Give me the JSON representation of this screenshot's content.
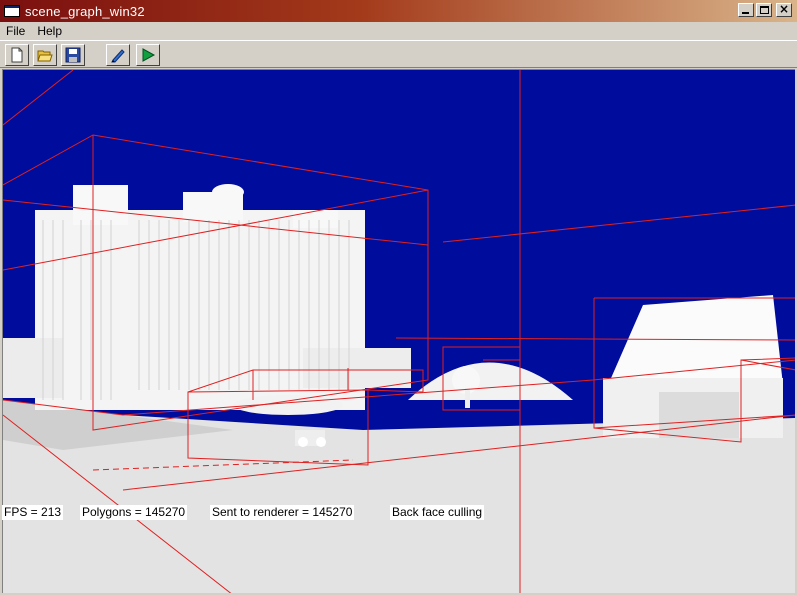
{
  "window": {
    "title": "scene_graph_win32"
  },
  "menu": {
    "file": "File",
    "help": "Help"
  },
  "toolbar": {
    "buttons": [
      {
        "name": "new-icon"
      },
      {
        "name": "open-folder-icon"
      },
      {
        "name": "save-icon"
      },
      {
        "name": "pencil-icon"
      },
      {
        "name": "play-icon"
      }
    ]
  },
  "viewport": {
    "background": "#000c9b",
    "bounding_box_color": "#e02020",
    "ground_color": "#e6e6e6"
  },
  "status": {
    "fps": "FPS = 213",
    "polygons": "Polygons = 145270",
    "sent": "Sent to renderer = 145270",
    "culling": "Back face culling"
  }
}
